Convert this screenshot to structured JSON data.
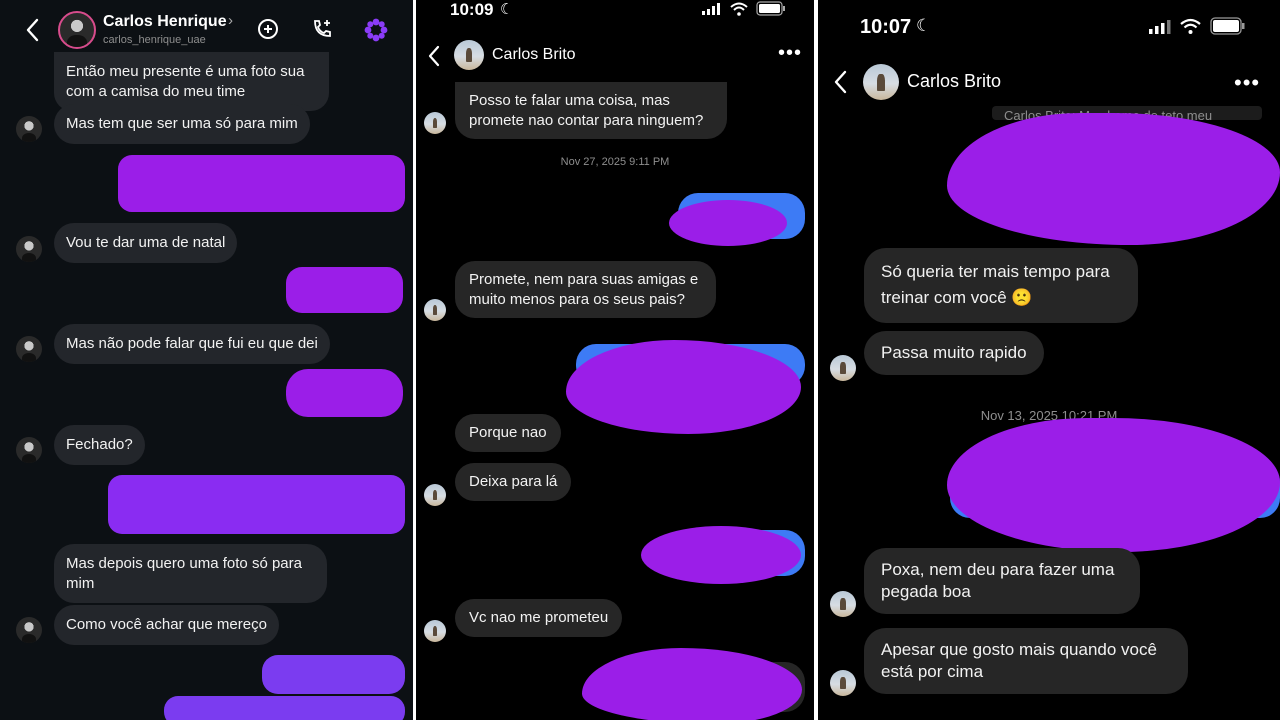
{
  "panel1": {
    "contact_name": "Carlos Henrique",
    "contact_handle": "carlos_henrique_uae",
    "messages": [
      "Então meu presente é uma foto sua com a camisa do meu time",
      "Mas tem que ser uma só para mim",
      "Vou te dar uma de natal",
      "Mas não pode falar que fui eu que dei",
      "Fechado?",
      "Mas depois quero uma foto só para mim",
      "Como você achar que mereço"
    ]
  },
  "panel2": {
    "time": "10:09",
    "contact_name": "Carlos Brito",
    "date_divider": "Nov 27, 2025 9:11 PM",
    "messages": [
      "Posso te falar uma coisa, mas promete nao contar para ninguem?",
      "Promete, nem para suas amigas e muito menos para os seus pais?",
      "Porque nao",
      "Deixa para lá",
      "Vc nao me prometeu"
    ]
  },
  "panel3": {
    "time": "10:07",
    "contact_name": "Carlos Brito",
    "reply_preview": "Carlos Brito: Me chama de teto meu",
    "date_divider": "Nov 13, 2025 10:21 PM",
    "messages": [
      "Só queria ter mais tempo para treinar com você 🙁",
      "Passa muito rapido",
      "Poxa, nem deu para fazer uma pegada boa",
      "Apesar que gosto mais quando você está por cima"
    ]
  },
  "colors": {
    "redaction": "#9b1ee8",
    "sent_bubble_p1": "#7b3cf0",
    "sent_bubble_p2": "#3d7bf5",
    "accent_icon": "#8b3cf7"
  }
}
